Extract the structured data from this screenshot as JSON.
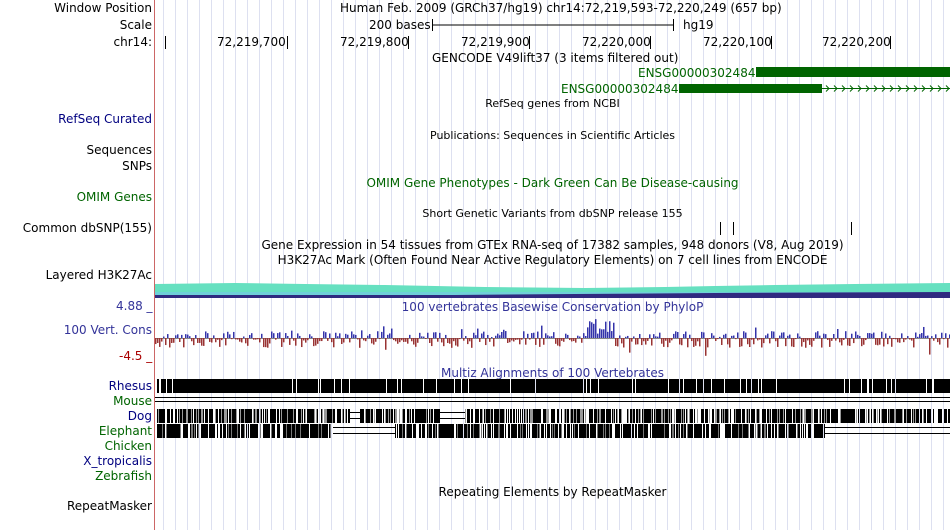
{
  "header": {
    "window_position_label": "Window Position",
    "scale_label": "Scale",
    "chrom_label": "chr14:",
    "assembly_text": "Human Feb. 2009 (GRCh37/hg19)   chr14:72,219,593-72,220,249 (657 bp)",
    "scale_text": "200 bases",
    "scale_db": "hg19",
    "ruler_ticks": [
      "72,219,700",
      "72,219,800",
      "72,219,900",
      "72,220,000",
      "72,220,100",
      "72,220,200"
    ]
  },
  "tracks": {
    "gencode": {
      "title": "GENCODE V49lift37 (3 items filtered out)",
      "genes": [
        "ENSG00000302484",
        "ENSG00000302484"
      ],
      "color": "#006400"
    },
    "refseq": {
      "label": "RefSeq Curated",
      "title": "RefSeq genes from NCBI"
    },
    "publications": {
      "title": "Publications: Sequences in Scientific Articles"
    },
    "sequences": {
      "label": "Sequences"
    },
    "snps": {
      "label": "SNPs"
    },
    "omim": {
      "label": "OMIM Genes",
      "title": "OMIM Gene Phenotypes - Dark Green Can Be Disease-causing"
    },
    "dbsnp": {
      "label": "Common dbSNP(155)",
      "title": "Short Genetic Variants from dbSNP release 155"
    },
    "gtex": {
      "title": "Gene Expression in 54 tissues from GTEx RNA-seq of 17382 samples, 948 donors (V8, Aug 2019)"
    },
    "h3k27ac": {
      "label": "Layered H3K27Ac",
      "title": "H3K27Ac Mark (Often Found Near Active Regulatory Elements) on 7 cell lines from ENCODE"
    },
    "cons": {
      "label": "100 Vert. Cons",
      "max_label": "4.88 _",
      "min_label": "-4.5 _",
      "title": "100 vertebrates Basewise Conservation by PhyloP",
      "pos_color": "#3333aa",
      "neg_color": "#993333"
    },
    "multiz": {
      "title": "Multiz Alignments of 100 Vertebrates",
      "species": [
        "Rhesus",
        "Mouse",
        "Dog",
        "Elephant",
        "Chicken",
        "X_tropicalis",
        "Zebrafish"
      ]
    },
    "repeatmasker": {
      "label": "RepeatMasker",
      "title": "Repeating Elements by RepeatMasker"
    }
  }
}
